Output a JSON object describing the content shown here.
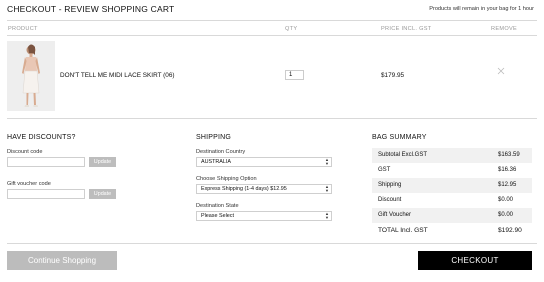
{
  "header": {
    "title": "CHECKOUT - REVIEW SHOPPING CART",
    "note": "Products will remain in your bag for 1 hour"
  },
  "columns": {
    "product": "PRODUCT",
    "qty": "QTY",
    "price": "PRICE INCL. GST",
    "remove": "REMOVE"
  },
  "cart_item": {
    "name": "DON'T TELL ME MIDI LACE SKIRT (06)",
    "qty": "1",
    "price": "$179.95",
    "remove_icon": "close-icon"
  },
  "discounts": {
    "title": "HAVE DISCOUNTS?",
    "discount_label": "Discount code",
    "discount_button": "Update",
    "voucher_label": "Gift voucher code",
    "voucher_button": "Update"
  },
  "shipping": {
    "title": "SHIPPING",
    "country_label": "Destination Country",
    "country_value": "AUSTRALIA",
    "option_label": "Choose Shipping Option",
    "option_value": "Express Shipping (1-4 days) $12.95",
    "state_label": "Destination State",
    "state_value": "Please Select"
  },
  "summary": {
    "title": "BAG SUMMARY",
    "rows": [
      {
        "label": "Subtotal Excl.GST",
        "value": "$163.59"
      },
      {
        "label": "GST",
        "value": "$16.36"
      },
      {
        "label": "Shipping",
        "value": "$12.95"
      },
      {
        "label": "Discount",
        "value": "$0.00"
      },
      {
        "label": "Gift Voucher",
        "value": "$0.00"
      },
      {
        "label": "TOTAL Incl. GST",
        "value": "$192.90"
      }
    ]
  },
  "actions": {
    "continue": "Continue Shopping",
    "checkout": "CHECKOUT"
  },
  "colors": {
    "checkout_bg": "#000000",
    "continue_bg": "#bcbcbc",
    "update_bg": "#bdbdbd"
  }
}
